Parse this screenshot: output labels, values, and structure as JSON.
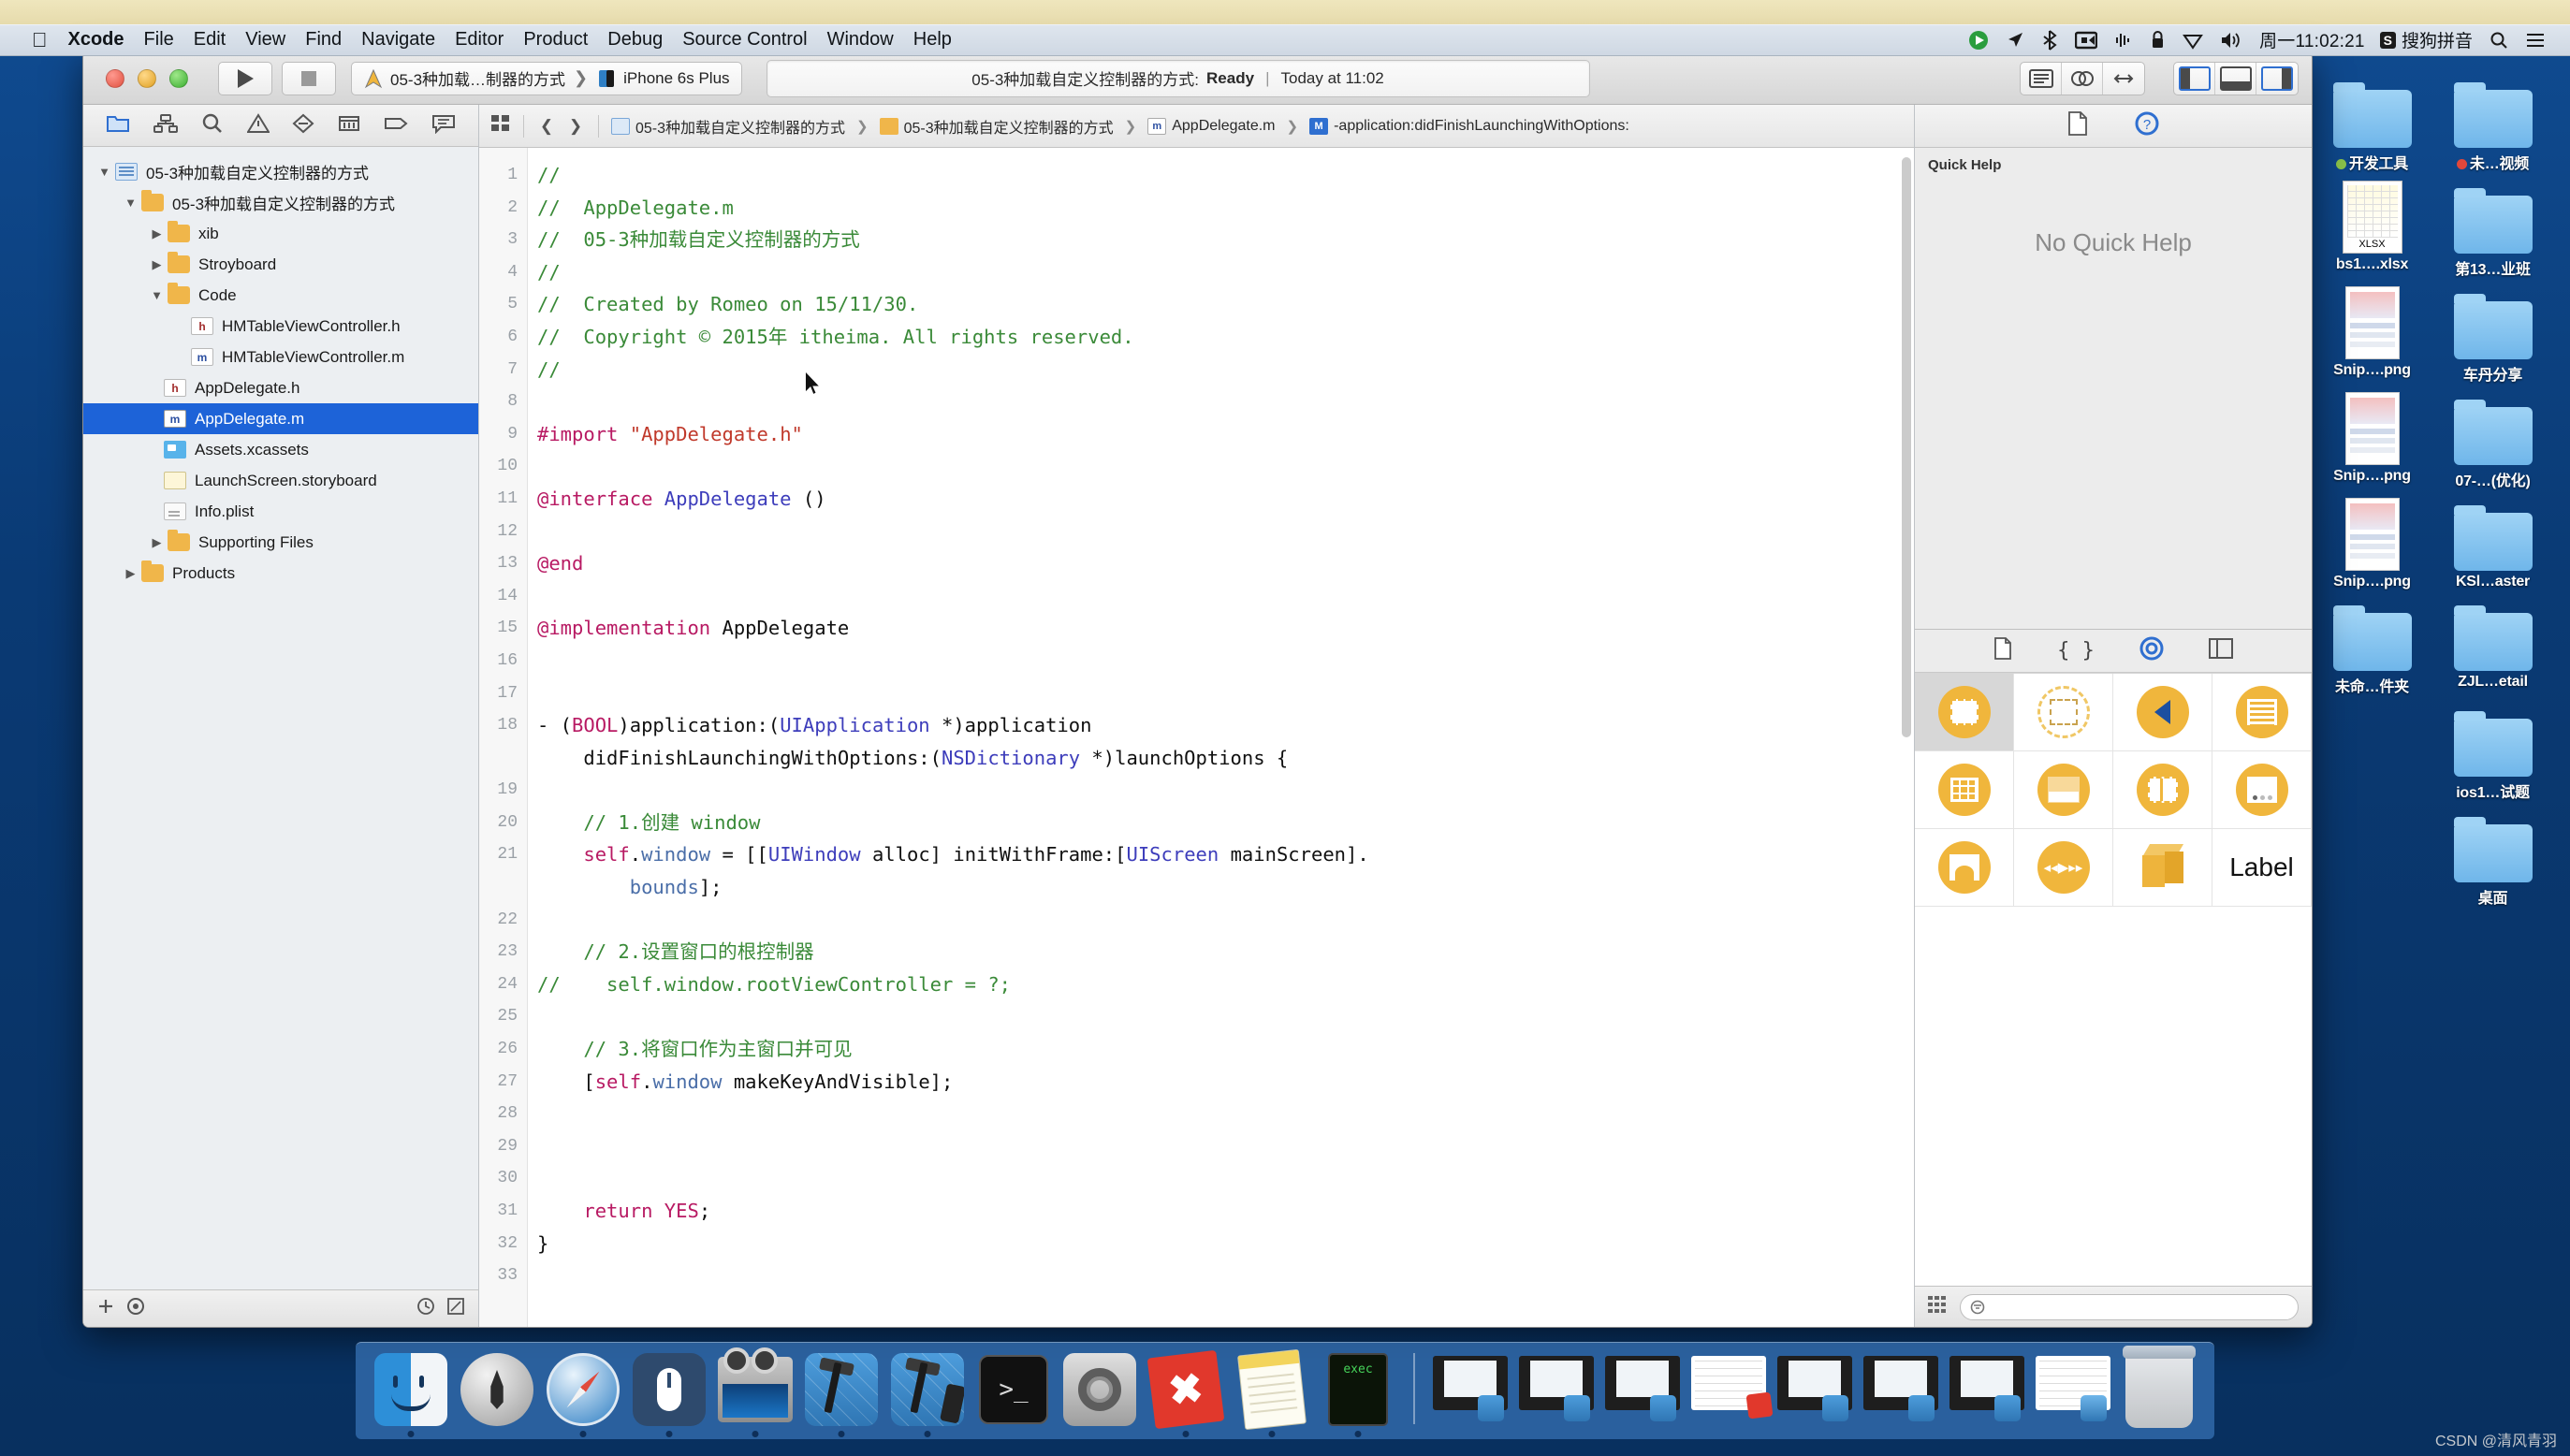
{
  "menubar": {
    "apple_icon": "apple-logo-icon",
    "items": [
      {
        "label": "Xcode",
        "bold": true
      },
      {
        "label": "File",
        "bold": false
      },
      {
        "label": "Edit",
        "bold": false
      },
      {
        "label": "View",
        "bold": false
      },
      {
        "label": "Find",
        "bold": false
      },
      {
        "label": "Navigate",
        "bold": false
      },
      {
        "label": "Editor",
        "bold": false
      },
      {
        "label": "Product",
        "bold": false
      },
      {
        "label": "Debug",
        "bold": false
      },
      {
        "label": "Source Control",
        "bold": false
      },
      {
        "label": "Window",
        "bold": false
      },
      {
        "label": "Help",
        "bold": false
      }
    ],
    "extras": [
      {
        "name": "dropbox-icon",
        "glyph": "◉"
      },
      {
        "name": "location-arrow-icon",
        "glyph": "➤"
      },
      {
        "name": "bluetooth-icon",
        "glyph": "✢"
      },
      {
        "name": "screen-recording-icon",
        "glyph": "⬛"
      },
      {
        "name": "audio-waveform-icon",
        "glyph": "⦀"
      },
      {
        "name": "lock-icon",
        "glyph": "🔒"
      },
      {
        "name": "wifi-icon",
        "glyph": "▽"
      },
      {
        "name": "volume-icon",
        "glyph": "🔊"
      }
    ],
    "clock": "周一11:02:21",
    "input_method_badge": "S",
    "input_method_label": "搜狗拼音",
    "search_icon": "search-icon",
    "control_center_icon": "list-icon"
  },
  "xcode": {
    "toolbar": {
      "run_icon": "run-play-icon",
      "stop_icon": "stop-square-icon",
      "scheme_name": "05-3种加载…制器的方式",
      "destination": "iPhone 6s Plus",
      "status_project": "05-3种加载自定义控制器的方式:",
      "status_state": "Ready",
      "status_time": "Today at 11:02",
      "editor_segments": [
        "standard-editor-icon",
        "assistant-editor-icon",
        "version-editor-icon"
      ],
      "panel_toggles": [
        "navigator-toggle-icon",
        "debug-area-toggle-icon",
        "utilities-toggle-icon"
      ]
    },
    "navigator": {
      "tabs": [
        "project-navigator-icon",
        "symbol-navigator-icon",
        "find-navigator-icon",
        "issue-navigator-icon",
        "test-navigator-icon",
        "debug-navigator-icon",
        "breakpoint-navigator-icon",
        "report-navigator-icon"
      ],
      "tree": [
        {
          "label": "05-3种加载自定义控制器的方式",
          "indent": 0,
          "tri": "▼",
          "icon": "proj",
          "selected": false
        },
        {
          "label": "05-3种加载自定义控制器的方式",
          "indent": 1,
          "tri": "▼",
          "icon": "folder",
          "selected": false
        },
        {
          "label": "xib",
          "indent": 2,
          "tri": "▶",
          "icon": "folder",
          "selected": false
        },
        {
          "label": "Stroyboard",
          "indent": 2,
          "tri": "▶",
          "icon": "folder",
          "selected": false
        },
        {
          "label": "Code",
          "indent": 2,
          "tri": "▼",
          "icon": "folder",
          "selected": false
        },
        {
          "label": "HMTableViewController.h",
          "indent": 3,
          "tri": "",
          "icon": "h",
          "selected": false
        },
        {
          "label": "HMTableViewController.m",
          "indent": 3,
          "tri": "",
          "icon": "m",
          "selected": false
        },
        {
          "label": "AppDelegate.h",
          "indent": 2,
          "tri": "",
          "icon": "h",
          "selected": false
        },
        {
          "label": "AppDelegate.m",
          "indent": 2,
          "tri": "",
          "icon": "m",
          "selected": true
        },
        {
          "label": "Assets.xcassets",
          "indent": 2,
          "tri": "",
          "icon": "xcassets",
          "selected": false
        },
        {
          "label": "LaunchScreen.storyboard",
          "indent": 2,
          "tri": "",
          "icon": "storyb",
          "selected": false
        },
        {
          "label": "Info.plist",
          "indent": 2,
          "tri": "",
          "icon": "plist",
          "selected": false
        },
        {
          "label": "Supporting Files",
          "indent": 2,
          "tri": "▶",
          "icon": "folder",
          "selected": false
        },
        {
          "label": "Products",
          "indent": 1,
          "tri": "▶",
          "icon": "folder",
          "selected": false
        }
      ],
      "footer": {
        "add_icon": "plus-icon",
        "filter_icon": "filter-circle-icon",
        "recent_icon": "recent-clock-icon",
        "sourcecontrol_icon": "source-control-icon"
      }
    },
    "jumpbar": {
      "related_icon": "related-items-icon",
      "back_icon": "back-chevron-icon",
      "forward_icon": "forward-chevron-icon",
      "crumbs": [
        {
          "label": "05-3种加载自定义控制器的方式",
          "badge": "proj"
        },
        {
          "label": "05-3种加载自定义控制器的方式",
          "badge": "fold"
        },
        {
          "label": "AppDelegate.m",
          "badge": "m"
        },
        {
          "label": "-application:didFinishLaunchingWithOptions:",
          "badge": "meth"
        }
      ]
    },
    "code": {
      "first_line": 1,
      "last_line": 33,
      "lines": [
        {
          "n": 1,
          "tokens": [
            {
              "t": "//",
              "c": "com"
            }
          ]
        },
        {
          "n": 2,
          "tokens": [
            {
              "t": "//  AppDelegate.m",
              "c": "com"
            }
          ]
        },
        {
          "n": 3,
          "tokens": [
            {
              "t": "//  05-3种加载自定义控制器的方式",
              "c": "com"
            }
          ]
        },
        {
          "n": 4,
          "tokens": [
            {
              "t": "//",
              "c": "com"
            }
          ]
        },
        {
          "n": 5,
          "tokens": [
            {
              "t": "//  Created by Romeo on 15/11/30.",
              "c": "com"
            }
          ]
        },
        {
          "n": 6,
          "tokens": [
            {
              "t": "//  Copyright © 2015年 itheima. All rights reserved.",
              "c": "com"
            }
          ]
        },
        {
          "n": 7,
          "tokens": [
            {
              "t": "//",
              "c": "com"
            }
          ]
        },
        {
          "n": 8,
          "tokens": []
        },
        {
          "n": 9,
          "tokens": [
            {
              "t": "#import ",
              "c": "key"
            },
            {
              "t": "\"AppDelegate.h\"",
              "c": "str"
            }
          ]
        },
        {
          "n": 10,
          "tokens": []
        },
        {
          "n": 11,
          "tokens": [
            {
              "t": "@interface ",
              "c": "key"
            },
            {
              "t": "AppDelegate",
              "c": "type"
            },
            {
              "t": " ()",
              "c": "plain"
            }
          ]
        },
        {
          "n": 12,
          "tokens": []
        },
        {
          "n": 13,
          "tokens": [
            {
              "t": "@end",
              "c": "key"
            }
          ]
        },
        {
          "n": 14,
          "tokens": []
        },
        {
          "n": 15,
          "tokens": [
            {
              "t": "@implementation ",
              "c": "key"
            },
            {
              "t": "AppDelegate",
              "c": "plain"
            }
          ]
        },
        {
          "n": 16,
          "tokens": []
        },
        {
          "n": 17,
          "tokens": []
        },
        {
          "n": 18,
          "tokens": [
            {
              "t": "- (",
              "c": "plain"
            },
            {
              "t": "BOOL",
              "c": "key"
            },
            {
              "t": ")application:(",
              "c": "plain"
            },
            {
              "t": "UIApplication",
              "c": "type"
            },
            {
              "t": " *)application",
              "c": "plain"
            }
          ]
        },
        {
          "n": null,
          "tokens": [
            {
              "t": "    didFinishLaunchingWithOptions:(",
              "c": "plain"
            },
            {
              "t": "NSDictionary",
              "c": "type"
            },
            {
              "t": " *)launchOptions {",
              "c": "plain"
            }
          ]
        },
        {
          "n": 19,
          "tokens": []
        },
        {
          "n": 20,
          "tokens": [
            {
              "t": "    // 1.创建 window",
              "c": "com"
            }
          ]
        },
        {
          "n": 21,
          "tokens": [
            {
              "t": "    ",
              "c": "plain"
            },
            {
              "t": "self",
              "c": "key"
            },
            {
              "t": ".",
              "c": "plain"
            },
            {
              "t": "window",
              "c": "prop"
            },
            {
              "t": " = [[",
              "c": "plain"
            },
            {
              "t": "UIWindow",
              "c": "type"
            },
            {
              "t": " alloc] initWithFrame:[",
              "c": "plain"
            },
            {
              "t": "UIScreen",
              "c": "type"
            },
            {
              "t": " mainScreen].",
              "c": "plain"
            }
          ]
        },
        {
          "n": null,
          "tokens": [
            {
              "t": "        ",
              "c": "plain"
            },
            {
              "t": "bounds",
              "c": "prop"
            },
            {
              "t": "];",
              "c": "plain"
            }
          ]
        },
        {
          "n": 22,
          "tokens": []
        },
        {
          "n": 23,
          "tokens": [
            {
              "t": "    // 2.设置窗口的根控制器",
              "c": "com"
            }
          ]
        },
        {
          "n": 24,
          "tokens": [
            {
              "t": "//    self.window.rootViewController = ?;",
              "c": "com"
            }
          ]
        },
        {
          "n": 25,
          "tokens": []
        },
        {
          "n": 26,
          "tokens": [
            {
              "t": "    // 3.将窗口作为主窗口并可见",
              "c": "com"
            }
          ]
        },
        {
          "n": 27,
          "tokens": [
            {
              "t": "    [",
              "c": "plain"
            },
            {
              "t": "self",
              "c": "key"
            },
            {
              "t": ".",
              "c": "plain"
            },
            {
              "t": "window",
              "c": "prop"
            },
            {
              "t": " makeKeyAndVisible];",
              "c": "plain"
            }
          ]
        },
        {
          "n": 28,
          "tokens": []
        },
        {
          "n": 29,
          "tokens": []
        },
        {
          "n": 30,
          "tokens": []
        },
        {
          "n": 31,
          "tokens": [
            {
              "t": "    ",
              "c": "plain"
            },
            {
              "t": "return",
              "c": "key"
            },
            {
              "t": " ",
              "c": "plain"
            },
            {
              "t": "YES",
              "c": "key"
            },
            {
              "t": ";",
              "c": "plain"
            }
          ]
        },
        {
          "n": 32,
          "tokens": [
            {
              "t": "}",
              "c": "plain"
            }
          ]
        },
        {
          "n": 33,
          "tokens": []
        }
      ]
    },
    "utility": {
      "inspector_tabs": [
        "file-inspector-icon",
        "quick-help-inspector-icon"
      ],
      "quick_help_title": "Quick Help",
      "quick_help_empty": "No Quick Help",
      "library_tabs": [
        "file-template-library-icon",
        "code-snippet-library-icon",
        "object-library-icon",
        "media-library-icon"
      ],
      "library_items": [
        {
          "name": "view-controller-object",
          "kind": "view-controller",
          "selected": true
        },
        {
          "name": "storyboard-reference-object",
          "kind": "storyboard-ref",
          "selected": false
        },
        {
          "name": "navigation-controller-object",
          "kind": "nav-controller",
          "selected": false
        },
        {
          "name": "table-view-controller-object",
          "kind": "table-controller",
          "selected": false
        },
        {
          "name": "collection-view-controller-object",
          "kind": "collection-controller",
          "selected": false
        },
        {
          "name": "tab-bar-controller-object",
          "kind": "tabbar-controller",
          "selected": false
        },
        {
          "name": "split-view-controller-object",
          "kind": "split-controller",
          "selected": false
        },
        {
          "name": "page-view-controller-object",
          "kind": "page-controller",
          "selected": false
        },
        {
          "name": "image-picker-controller-object",
          "kind": "imagepicker-controller",
          "selected": false
        },
        {
          "name": "av-player-controller-object",
          "kind": "avplayer-controller",
          "selected": false
        },
        {
          "name": "glkit-view-controller-object",
          "kind": "glkit-controller",
          "selected": false
        },
        {
          "name": "label-object",
          "kind": "label",
          "label": "Label",
          "selected": false
        }
      ],
      "library_footer": {
        "view_toggle_icon": "grid-view-icon",
        "filter_placeholder": ""
      }
    }
  },
  "desktop": {
    "icons": [
      {
        "label": "开发工具",
        "kind": "folder",
        "dot": "#8bc34a"
      },
      {
        "label": "未…视频",
        "kind": "folder",
        "dot": "#e0473a"
      },
      {
        "label": "bs1….xlsx",
        "kind": "xlsx",
        "dot": ""
      },
      {
        "label": "第13…业班",
        "kind": "folder",
        "dot": ""
      },
      {
        "label": "Snip….png",
        "kind": "png",
        "dot": ""
      },
      {
        "label": "车丹分享",
        "kind": "folder",
        "dot": ""
      },
      {
        "label": "Snip….png",
        "kind": "png",
        "dot": ""
      },
      {
        "label": "07-…(优化)",
        "kind": "folder",
        "dot": ""
      },
      {
        "label": "Snip….png",
        "kind": "png",
        "dot": ""
      },
      {
        "label": "KSl…aster",
        "kind": "folder",
        "dot": ""
      },
      {
        "label": "未命…件夹",
        "kind": "folder",
        "dot": ""
      },
      {
        "label": "ZJL…etail",
        "kind": "folder",
        "dot": ""
      },
      {
        "label": "",
        "kind": "none",
        "dot": ""
      },
      {
        "label": "ios1…试题",
        "kind": "folder",
        "dot": ""
      },
      {
        "label": "",
        "kind": "none",
        "dot": ""
      },
      {
        "label": "桌面",
        "kind": "folder",
        "dot": ""
      }
    ]
  },
  "dock": {
    "items": [
      {
        "name": "finder-icon",
        "kind": "finder",
        "running": true
      },
      {
        "name": "launchpad-icon",
        "kind": "launchpad",
        "running": false
      },
      {
        "name": "safari-icon",
        "kind": "safari",
        "running": true
      },
      {
        "name": "mouse-app-icon",
        "kind": "mouse",
        "running": true
      },
      {
        "name": "quicktime-icon",
        "kind": "quicktime",
        "running": true
      },
      {
        "name": "xcode-icon",
        "kind": "xcode",
        "running": true
      },
      {
        "name": "xcode-beta-icon",
        "kind": "xcode",
        "running": true
      },
      {
        "name": "terminal-icon",
        "kind": "terminal",
        "running": false
      },
      {
        "name": "system-preferences-icon",
        "kind": "sysprefs",
        "running": false
      },
      {
        "name": "xmind-icon",
        "kind": "xmind",
        "running": true
      },
      {
        "name": "notes-icon",
        "kind": "notes",
        "running": true
      },
      {
        "name": "exec-icon",
        "kind": "exec",
        "running": true
      }
    ],
    "minimized": [
      {
        "name": "minimized-window",
        "kind": "window"
      },
      {
        "name": "minimized-window",
        "kind": "window"
      },
      {
        "name": "minimized-window",
        "kind": "window"
      },
      {
        "name": "minimized-document",
        "kind": "doc"
      },
      {
        "name": "minimized-window",
        "kind": "window"
      },
      {
        "name": "minimized-window",
        "kind": "window"
      },
      {
        "name": "minimized-window",
        "kind": "window"
      },
      {
        "name": "minimized-document",
        "kind": "doc"
      }
    ],
    "trash": {
      "name": "trash-icon"
    }
  },
  "watermark": "CSDN @清风青羽"
}
